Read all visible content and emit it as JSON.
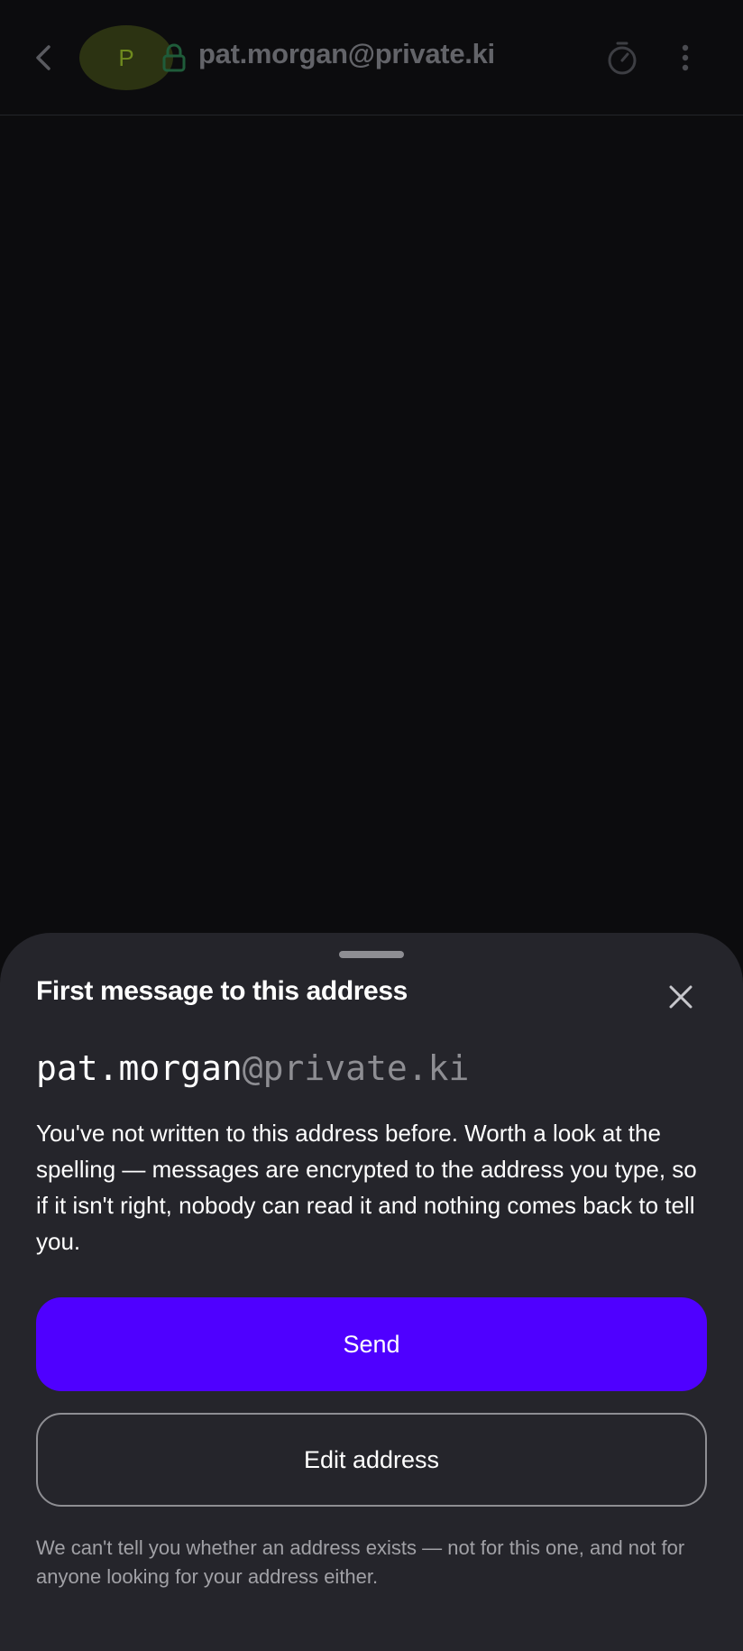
{
  "header": {
    "avatar_initial": "P",
    "address": "pat.morgan@private.ki",
    "icons": {
      "back": "chevron-left-icon",
      "lock": "lock-icon",
      "timer": "timer-icon",
      "more": "more-vertical-icon"
    }
  },
  "sheet": {
    "title": "First message to this address",
    "address_local": "pat.morgan",
    "address_domain": "@private.ki",
    "body": "You've not written to this address before. Worth a look at the spelling — messages are encrypted to the address you type, so if it isn't right, nobody can read it and nothing comes back to tell you.",
    "send_label": "Send",
    "edit_label": "Edit address",
    "footnote": "We can't tell you whether an address exists — not for this one, and not for anyone looking for your address either.",
    "icons": {
      "close": "close-icon"
    }
  },
  "colors": {
    "background": "#0c0c0e",
    "sheet": "#25252b",
    "primary": "#4f00ff",
    "lock": "#1f5c3a",
    "avatar_bg": "#2c3312",
    "avatar_text": "#6f8a1e"
  }
}
